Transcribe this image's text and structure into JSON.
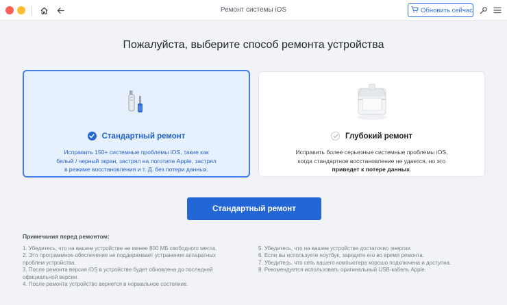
{
  "window": {
    "title": "Ремонт системы iOS",
    "update_button": "Обновить сейчас"
  },
  "main": {
    "heading": "Пожалуйста, выберите способ ремонта устройства"
  },
  "standard_repair": {
    "title": "Стандартный ремонт",
    "desc_line1": "Исправить 150+ системные проблемы iOS, такие как",
    "desc_line2": "белый / черный экран, застрял на логотипе Apple, застрял",
    "desc_line3": "в режиме восстановления и т. Д. без потери данных.",
    "selected": true
  },
  "deep_repair": {
    "title": "Глубокий ремонт",
    "desc_line1": "Исправить более серьезные системные проблемы iOS,",
    "desc_line2": "когда стандартное восстановление не удается, но это",
    "desc_line3_bold": "приведет к потере данных",
    "desc_line3_end": "."
  },
  "action": {
    "primary_button": "Стандартный ремонт"
  },
  "notes": {
    "title": "Примечания перед ремонтом:",
    "left": [
      "1. Убедитесь, что на вашем устройстве не менее 800 МБ свободного места.",
      "2. Это программное обеспечение не поддерживает устранение аппаратных",
      "проблем устройства.",
      "3. После ремонта версия iOS в устройстве будет обновлена до последней",
      "официальной версии.",
      "4. После ремонта устройство вернется в нормальное состояние."
    ],
    "right": [
      "5. Убедитесь, что на вашем устройстве достаточно энергии.",
      "6. Если вы используете ноутбук, зарядите его во время ремонта.",
      "7. Убедитесь, что сеть вашего компьютера хорошо подключена и доступна.",
      "8. Рекомендуется использовать оригинальный USB-кабель Apple."
    ]
  },
  "colors": {
    "accent": "#2367d6",
    "selected_bg": "#e7f0fd",
    "page_bg": "#f1f3f7"
  }
}
